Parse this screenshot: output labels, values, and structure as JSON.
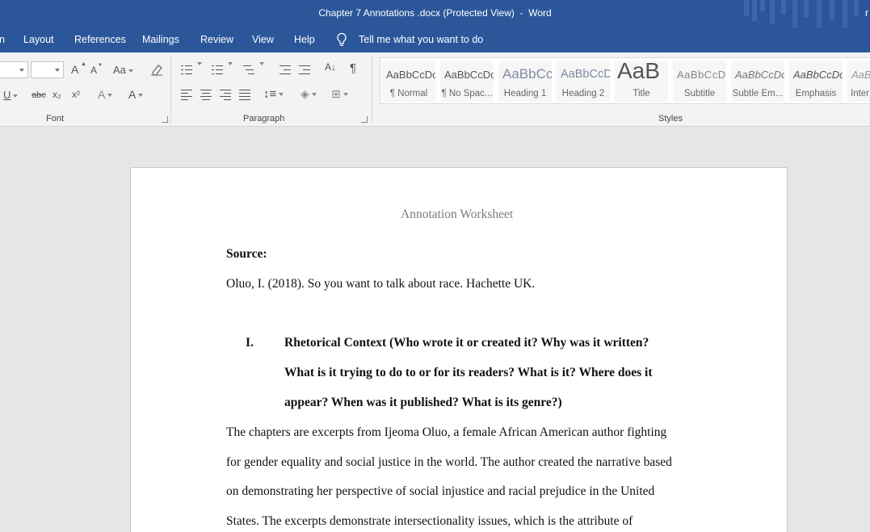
{
  "window": {
    "title": "Chapter 7 Annotations .docx (Protected View)  -  Word",
    "cut_text": "r"
  },
  "ribbon_tabs": {
    "partial_left": "n",
    "items": [
      "Layout",
      "References",
      "Mailings",
      "Review",
      "View",
      "Help"
    ],
    "tell_me": "Tell me what you want to do"
  },
  "ribbon": {
    "groups": {
      "font": "Font",
      "paragraph": "Paragraph",
      "styles": "Styles"
    },
    "font_buttons": {
      "grow": "A",
      "shrink": "A",
      "change_case": "Aa",
      "underline": "U",
      "strikethrough": "abc",
      "subscript": "x₂",
      "superscript": "x²",
      "text_effects": "A",
      "font_color": "A"
    },
    "styles": [
      {
        "sample": "AaBbCcDc",
        "label": "¶ Normal"
      },
      {
        "sample": "AaBbCcDc",
        "label": "¶ No Spac..."
      },
      {
        "sample": "AaBbCc",
        "label": "Heading 1"
      },
      {
        "sample": "AaBbCcD",
        "label": "Heading 2"
      },
      {
        "sample": "AaB",
        "label": "Title"
      },
      {
        "sample": "AaBbCcD",
        "label": "Subtitle"
      },
      {
        "sample": "AaBbCcDd",
        "label": "Subtle Em..."
      },
      {
        "sample": "AaBbCcDd",
        "label": "Emphasis"
      },
      {
        "sample": "AaBl",
        "label": "Inter"
      }
    ]
  },
  "document": {
    "header": "Annotation Worksheet",
    "source_label": "Source:",
    "citation": "Oluo, I. (2018). So you want to talk about race. Hachette UK.",
    "section_number": "I.",
    "section_heading_lines": [
      "Rhetorical Context (Who wrote it or created it? Why was it written?",
      "What is it trying to do to or for its readers? What is it? Where does it",
      "appear? When was it published? What is its genre?)"
    ],
    "body_lines": [
      "The chapters are excerpts from Ijeoma Oluo, a female African American author fighting",
      "for gender equality and social justice in the world. The author created the narrative based",
      "on demonstrating her perspective of social injustice and racial prejudice in the United",
      "States. The excerpts demonstrate intersectionality issues, which is the attribute of"
    ]
  }
}
